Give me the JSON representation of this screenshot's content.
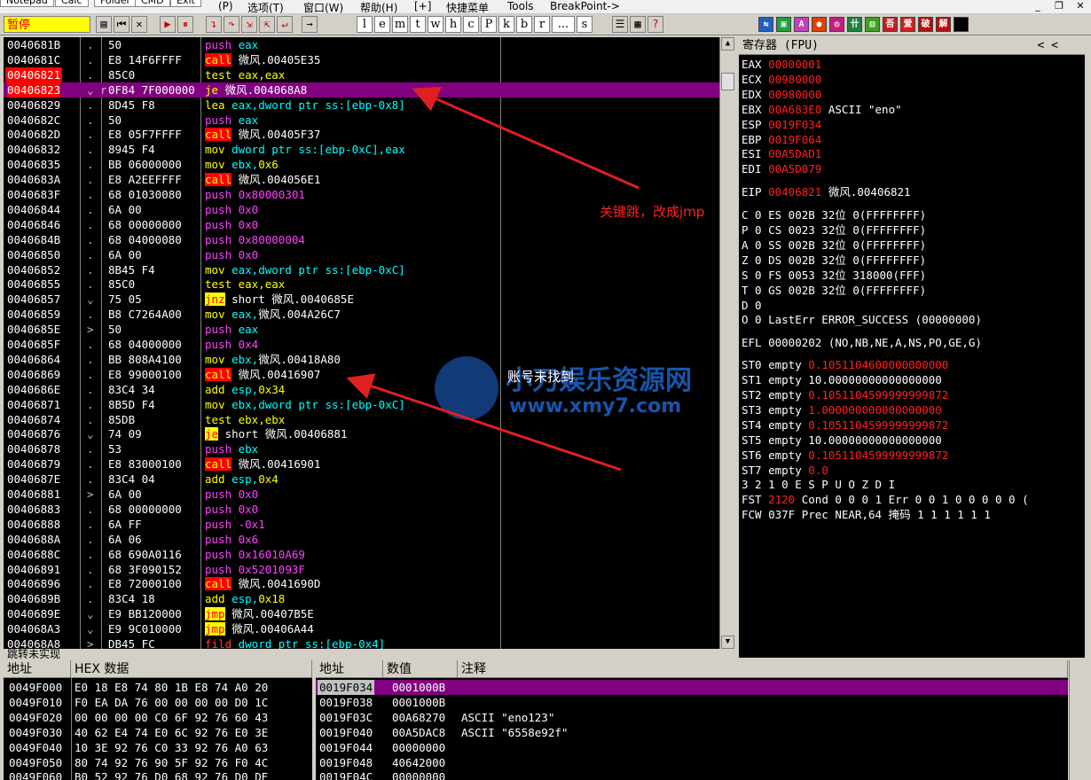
{
  "menubar": {
    "items": [
      "Notepad",
      "Calc",
      "Folder",
      "CMD",
      "Exit"
    ],
    "menus": [
      "(P)",
      "选项(T)",
      "窗口(W)",
      "帮助(H)",
      "[+]",
      "快捷菜单",
      "Tools",
      "BreakPoint->"
    ],
    "controls": [
      "_",
      "❐",
      "✕"
    ]
  },
  "toolbar": {
    "status": "暂停",
    "letters": [
      "l",
      "e",
      "m",
      "t",
      "w",
      "h",
      "c",
      "P",
      "k",
      "b",
      "r",
      "...",
      "s"
    ]
  },
  "cpu_rows": [
    {
      "addr": "0040681B",
      "mark": ".",
      "hex": "50",
      "dis": [
        [
          "k-push",
          "push"
        ],
        [
          "op-r",
          " eax"
        ]
      ]
    },
    {
      "addr": "0040681C",
      "mark": ".",
      "hex": "E8 14F6FFFF",
      "dis": [
        [
          "k-callbox",
          "call"
        ],
        [
          "",
          ""
        ],
        [
          "w",
          " 微风.00405E35"
        ]
      ]
    },
    {
      "addr": "00406821",
      "mark": ".",
      "hex": "85C0",
      "dis": [
        [
          "op-n",
          "test"
        ],
        [
          "op-n",
          " eax,eax"
        ]
      ],
      "sel": true
    },
    {
      "addr": "00406823",
      "mark": "⌄ r",
      "hex": "0F84 7F000000",
      "dis": [
        [
          "op-n",
          "je"
        ],
        [
          "w",
          " 微风.004068A8"
        ]
      ],
      "jhi": true
    },
    {
      "addr": "00406829",
      "mark": ".",
      "hex": "8D45 F8",
      "dis": [
        [
          "op-n",
          "lea"
        ],
        [
          "op-r",
          " eax,dword ptr ss:[ebp-0x8]"
        ]
      ]
    },
    {
      "addr": "0040682C",
      "mark": ".",
      "hex": "50",
      "dis": [
        [
          "k-push",
          "push"
        ],
        [
          "op-r",
          " eax"
        ]
      ]
    },
    {
      "addr": "0040682D",
      "mark": ".",
      "hex": "E8 05F7FFFF",
      "dis": [
        [
          "k-callbox",
          "call"
        ],
        [
          "w",
          " 微风.00405F37"
        ]
      ]
    },
    {
      "addr": "00406832",
      "mark": ".",
      "hex": "8945 F4",
      "dis": [
        [
          "op-n",
          "mov"
        ],
        [
          "op-r",
          " dword ptr ss:[ebp-0xC],eax"
        ]
      ]
    },
    {
      "addr": "00406835",
      "mark": ".",
      "hex": "BB 06000000",
      "dis": [
        [
          "op-n",
          "mov"
        ],
        [
          "op-r",
          " ebx,"
        ],
        [
          "op-n",
          "0x6"
        ]
      ]
    },
    {
      "addr": "0040683A",
      "mark": ".",
      "hex": "E8 A2EEFFFF",
      "dis": [
        [
          "k-callbox",
          "call"
        ],
        [
          "w",
          " 微风.004056E1"
        ]
      ]
    },
    {
      "addr": "0040683F",
      "mark": ".",
      "hex": "68 01030080",
      "dis": [
        [
          "k-push",
          "push"
        ],
        [
          "k-push",
          " 0x80000301"
        ]
      ]
    },
    {
      "addr": "00406844",
      "mark": ".",
      "hex": "6A 00",
      "dis": [
        [
          "k-push",
          "push"
        ],
        [
          "k-push",
          " 0x0"
        ]
      ]
    },
    {
      "addr": "00406846",
      "mark": ".",
      "hex": "68 00000000",
      "dis": [
        [
          "k-push",
          "push"
        ],
        [
          "k-push",
          " 0x0"
        ]
      ]
    },
    {
      "addr": "0040684B",
      "mark": ".",
      "hex": "68 04000080",
      "dis": [
        [
          "k-push",
          "push"
        ],
        [
          "k-push",
          " 0x80000004"
        ]
      ]
    },
    {
      "addr": "00406850",
      "mark": ".",
      "hex": "6A 00",
      "dis": [
        [
          "k-push",
          "push"
        ],
        [
          "k-push",
          " 0x0"
        ]
      ]
    },
    {
      "addr": "00406852",
      "mark": ".",
      "hex": "8B45 F4",
      "dis": [
        [
          "op-n",
          "mov"
        ],
        [
          "op-r",
          " eax,dword ptr ss:[ebp-0xC]"
        ]
      ]
    },
    {
      "addr": "00406855",
      "mark": ".",
      "hex": "85C0",
      "dis": [
        [
          "op-n",
          "test"
        ],
        [
          "op-n",
          " eax,eax"
        ]
      ]
    },
    {
      "addr": "00406857",
      "mark": "⌄",
      "hex": "75 05",
      "dis": [
        [
          "k-jmp",
          "jnz"
        ],
        [
          "w",
          " short 微风.0040685E"
        ]
      ]
    },
    {
      "addr": "00406859",
      "mark": ".",
      "hex": "B8 C7264A00",
      "dis": [
        [
          "op-n",
          "mov"
        ],
        [
          "op-r",
          " eax,"
        ],
        [
          "w",
          "微风.004A26C7"
        ]
      ]
    },
    {
      "addr": "0040685E",
      "mark": ">",
      "hex": "50",
      "dis": [
        [
          "k-push",
          "push"
        ],
        [
          "op-r",
          " eax"
        ]
      ]
    },
    {
      "addr": "0040685F",
      "mark": ".",
      "hex": "68 04000000",
      "dis": [
        [
          "k-push",
          "push"
        ],
        [
          "k-push",
          " 0x4"
        ]
      ]
    },
    {
      "addr": "00406864",
      "mark": ".",
      "hex": "BB 808A4100",
      "dis": [
        [
          "op-n",
          "mov"
        ],
        [
          "op-r",
          " ebx,"
        ],
        [
          "w",
          "微风.00418A80"
        ]
      ]
    },
    {
      "addr": "00406869",
      "mark": ".",
      "hex": "E8 99000100",
      "dis": [
        [
          "k-callbox",
          "call"
        ],
        [
          "w",
          " 微风.00416907"
        ]
      ]
    },
    {
      "addr": "0040686E",
      "mark": ".",
      "hex": "83C4 34",
      "dis": [
        [
          "op-n",
          "add"
        ],
        [
          "op-r",
          " esp,"
        ],
        [
          "op-n",
          "0x34"
        ]
      ]
    },
    {
      "addr": "00406871",
      "mark": ".",
      "hex": "8B5D F4",
      "dis": [
        [
          "op-n",
          "mov"
        ],
        [
          "op-r",
          " ebx,dword ptr ss:[ebp-0xC]"
        ]
      ]
    },
    {
      "addr": "00406874",
      "mark": ".",
      "hex": "85DB",
      "dis": [
        [
          "op-n",
          "test"
        ],
        [
          "op-n",
          " ebx,ebx"
        ]
      ]
    },
    {
      "addr": "00406876",
      "mark": "⌄",
      "hex": "74 09",
      "dis": [
        [
          "k-jmp",
          "je"
        ],
        [
          "w",
          " short 微风.00406881"
        ]
      ]
    },
    {
      "addr": "00406878",
      "mark": ".",
      "hex": "53",
      "dis": [
        [
          "k-push",
          "push"
        ],
        [
          "op-r",
          " ebx"
        ]
      ]
    },
    {
      "addr": "00406879",
      "mark": ".",
      "hex": "E8 83000100",
      "dis": [
        [
          "k-callbox",
          "call"
        ],
        [
          "w",
          " 微风.00416901"
        ]
      ]
    },
    {
      "addr": "0040687E",
      "mark": ".",
      "hex": "83C4 04",
      "dis": [
        [
          "op-n",
          "add"
        ],
        [
          "op-r",
          " esp,"
        ],
        [
          "op-n",
          "0x4"
        ]
      ]
    },
    {
      "addr": "00406881",
      "mark": ">",
      "hex": "6A 00",
      "dis": [
        [
          "k-push",
          "push"
        ],
        [
          "k-push",
          " 0x0"
        ]
      ]
    },
    {
      "addr": "00406883",
      "mark": ".",
      "hex": "68 00000000",
      "dis": [
        [
          "k-push",
          "push"
        ],
        [
          "k-push",
          " 0x0"
        ]
      ]
    },
    {
      "addr": "00406888",
      "mark": ".",
      "hex": "6A FF",
      "dis": [
        [
          "k-push",
          "push"
        ],
        [
          "k-push",
          " -0x1"
        ]
      ]
    },
    {
      "addr": "0040688A",
      "mark": ".",
      "hex": "6A 06",
      "dis": [
        [
          "k-push",
          "push"
        ],
        [
          "k-push",
          " 0x6"
        ]
      ]
    },
    {
      "addr": "0040688C",
      "mark": ".",
      "hex": "68 690A0116",
      "dis": [
        [
          "k-push",
          "push"
        ],
        [
          "k-push",
          " 0x16010A69"
        ]
      ]
    },
    {
      "addr": "00406891",
      "mark": ".",
      "hex": "68 3F090152",
      "dis": [
        [
          "k-push",
          "push"
        ],
        [
          "k-push",
          " 0x5201093F"
        ]
      ]
    },
    {
      "addr": "00406896",
      "mark": ".",
      "hex": "E8 72000100",
      "dis": [
        [
          "k-callbox",
          "call"
        ],
        [
          "w",
          " 微风.0041690D"
        ]
      ]
    },
    {
      "addr": "0040689B",
      "mark": ".",
      "hex": "83C4 18",
      "dis": [
        [
          "op-n",
          "add"
        ],
        [
          "op-r",
          " esp,"
        ],
        [
          "op-n",
          "0x18"
        ]
      ]
    },
    {
      "addr": "0040689E",
      "mark": "⌄",
      "hex": "E9 BB120000",
      "dis": [
        [
          "k-jmp",
          "jmp"
        ],
        [
          "w",
          " 微风.00407B5E"
        ]
      ]
    },
    {
      "addr": "004068A3",
      "mark": "⌄",
      "hex": "E9 9C010000",
      "dis": [
        [
          "k-jmp",
          "jmp"
        ],
        [
          "w",
          " 微风.00406A44"
        ]
      ]
    },
    {
      "addr": "004068A8",
      "mark": ">",
      "hex": "DB45 FC",
      "dis": [
        [
          "op-red",
          "fild"
        ],
        [
          "op-r",
          " dword ptr ss:[ebp-0x4]"
        ]
      ]
    }
  ],
  "info_line": "跳转未实现",
  "registers": {
    "title": "寄存器 (FPU)",
    "nav": "<   <",
    "gp": [
      {
        "n": "EAX",
        "v": "00000001",
        "x": ""
      },
      {
        "n": "ECX",
        "v": "00980000",
        "x": ""
      },
      {
        "n": "EDX",
        "v": "00980000",
        "x": ""
      },
      {
        "n": "EBX",
        "v": "00A683E0",
        "x": " ASCII \"eno\""
      },
      {
        "n": "ESP",
        "v": "0019F034",
        "x": ""
      },
      {
        "n": "EBP",
        "v": "0019F064",
        "x": ""
      },
      {
        "n": "ESI",
        "v": "00A5DAD1",
        "x": ""
      },
      {
        "n": "EDI",
        "v": "00A5D079",
        "x": ""
      }
    ],
    "eip": {
      "n": "EIP",
      "v": "00406821",
      "x": " 微风.00406821"
    },
    "flags": [
      "C 0   ES 002B 32位 0(FFFFFFFF)",
      "P 0   CS 0023 32位 0(FFFFFFFF)",
      "A 0   SS 002B 32位 0(FFFFFFFF)",
      "Z 0   DS 002B 32位 0(FFFFFFFF)",
      "S 0   FS 0053 32位 318000(FFF)",
      "T 0   GS 002B 32位 0(FFFFFFFF)",
      "D 0",
      "O 0   LastErr ERROR_SUCCESS (00000000)"
    ],
    "efl": "EFL 00000202 (NO,NB,NE,A,NS,PO,GE,G)",
    "fpu": [
      {
        "n": "ST0 empty ",
        "v": "0.1051104600000000000"
      },
      {
        "n": "ST1 empty ",
        "v": "",
        "w": "10.00000000000000000"
      },
      {
        "n": "ST2 empty ",
        "v": "0.1051104599999999872"
      },
      {
        "n": "ST3 empty ",
        "v": "1.000000000000000000"
      },
      {
        "n": "ST4 empty ",
        "v": "0.1051104599999999872"
      },
      {
        "n": "ST5 empty ",
        "v": "",
        "w": "10.00000000000000000"
      },
      {
        "n": "ST6 empty ",
        "v": "0.1051104599999999872"
      },
      {
        "n": "ST7 empty ",
        "v": "0.0"
      }
    ],
    "fst_head": "              3 2 1 0       E S P U O Z D I",
    "fst": {
      "a": "FST ",
      "v": "2120",
      "b": "  Cond 0 0 0 1  Err 0 0 1 0 0 0 0 0  ("
    },
    "fcw": "FCW 037F  Prec NEAR,64  掩码     1 1 1 1 1 1"
  },
  "dump": {
    "header_addr": "地址",
    "header_hex": "HEX 数据",
    "rows": [
      {
        "a": "0049F000",
        "h": "E0 18 E8 74 80 1B E8 74 A0 20"
      },
      {
        "a": "0049F010",
        "h": "F0 EA DA 76 00 00 00 00 D0 1C"
      },
      {
        "a": "0049F020",
        "h": "00 00 00 00 C0 6F 92 76 60 43"
      },
      {
        "a": "0049F030",
        "h": "40 62 E4 74 E0 6C 92 76 E0 3E"
      },
      {
        "a": "0049F040",
        "h": "10 3E 92 76 C0 33 92 76 A0 63"
      },
      {
        "a": "0049F050",
        "h": "80 74 92 76 90 5F 92 76 F0 4C"
      },
      {
        "a": "0049F060",
        "h": "B0 52 92 76 D0 68 92 76 D0 DE"
      }
    ]
  },
  "stack": {
    "header_addr": "地址",
    "header_val": "数值",
    "header_cmt": "注释",
    "rows": [
      {
        "a": "0019F034",
        "v": "0001000B",
        "c": "",
        "sel": true
      },
      {
        "a": "0019F038",
        "v": "0001000B",
        "c": ""
      },
      {
        "a": "0019F03C",
        "v": "00A68270",
        "c": "ASCII \"eno123\""
      },
      {
        "a": "0019F040",
        "v": "00A5DAC8",
        "c": "ASCII \"6558e92f\""
      },
      {
        "a": "0019F044",
        "v": "00000000",
        "c": ""
      },
      {
        "a": "0019F048",
        "v": "40642000",
        "c": ""
      },
      {
        "a": "0019F04C",
        "v": "00000000",
        "c": ""
      }
    ]
  },
  "annotations": {
    "key_jump": "关键跳，改成jmp",
    "not_found": "账号未找到"
  },
  "watermark": {
    "line1": "小刀娱乐资源网",
    "line2": "www.xmy7.com"
  },
  "colors": {
    "accent_purple": "#800080",
    "selection_red": "#ff0000",
    "annot_red": "#e02020"
  }
}
